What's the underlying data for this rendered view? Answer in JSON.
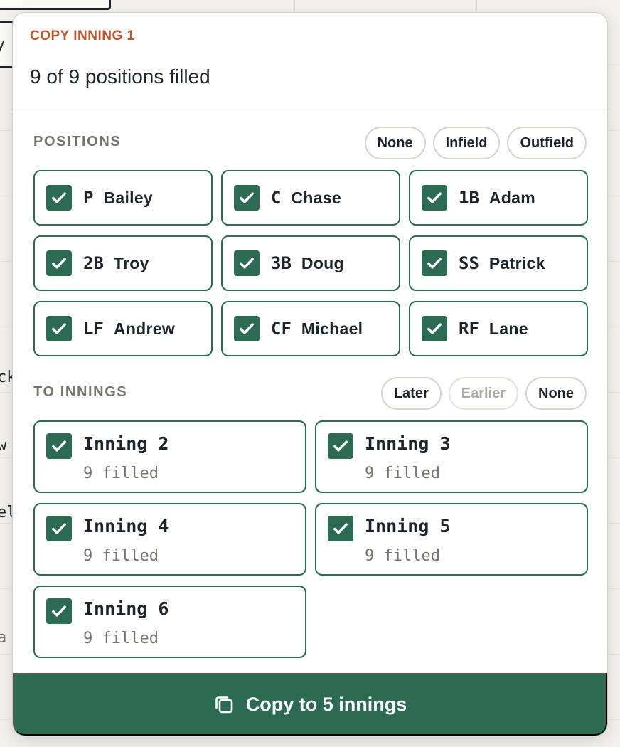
{
  "popover": {
    "eyebrow": "COPY INNING 1",
    "subtitle": "9 of 9 positions filled"
  },
  "positions_section": {
    "label": "POSITIONS",
    "filters": [
      {
        "label": "None",
        "enabled": true
      },
      {
        "label": "Infield",
        "enabled": true
      },
      {
        "label": "Outfield",
        "enabled": true
      }
    ],
    "items": [
      {
        "abbr": "P",
        "player": "Bailey",
        "checked": true
      },
      {
        "abbr": "C",
        "player": "Chase",
        "checked": true
      },
      {
        "abbr": "1B",
        "player": "Adam",
        "checked": true
      },
      {
        "abbr": "2B",
        "player": "Troy",
        "checked": true
      },
      {
        "abbr": "3B",
        "player": "Doug",
        "checked": true
      },
      {
        "abbr": "SS",
        "player": "Patrick",
        "checked": true
      },
      {
        "abbr": "LF",
        "player": "Andrew",
        "checked": true
      },
      {
        "abbr": "CF",
        "player": "Michael",
        "checked": true
      },
      {
        "abbr": "RF",
        "player": "Lane",
        "checked": true
      }
    ]
  },
  "innings_section": {
    "label": "TO INNINGS",
    "filters": [
      {
        "label": "Later",
        "enabled": true
      },
      {
        "label": "Earlier",
        "enabled": false
      },
      {
        "label": "None",
        "enabled": true
      }
    ],
    "items": [
      {
        "title": "Inning 2",
        "sub": "9 filled",
        "checked": true
      },
      {
        "title": "Inning 3",
        "sub": "9 filled",
        "checked": true
      },
      {
        "title": "Inning 4",
        "sub": "9 filled",
        "checked": true
      },
      {
        "title": "Inning 5",
        "sub": "9 filled",
        "checked": true
      },
      {
        "title": "Inning 6",
        "sub": "9 filled",
        "checked": true
      }
    ]
  },
  "copy_button": {
    "label": "Copy to 5 innings",
    "icon": "copy-icon"
  },
  "background": {
    "fragments": [
      "y",
      "ck",
      "w",
      "el",
      "a"
    ]
  },
  "colors": {
    "accent": "#2c6b52",
    "eyebrow": "#c0532a",
    "muted": "#74736d",
    "disabled": "#a9a8a3"
  }
}
